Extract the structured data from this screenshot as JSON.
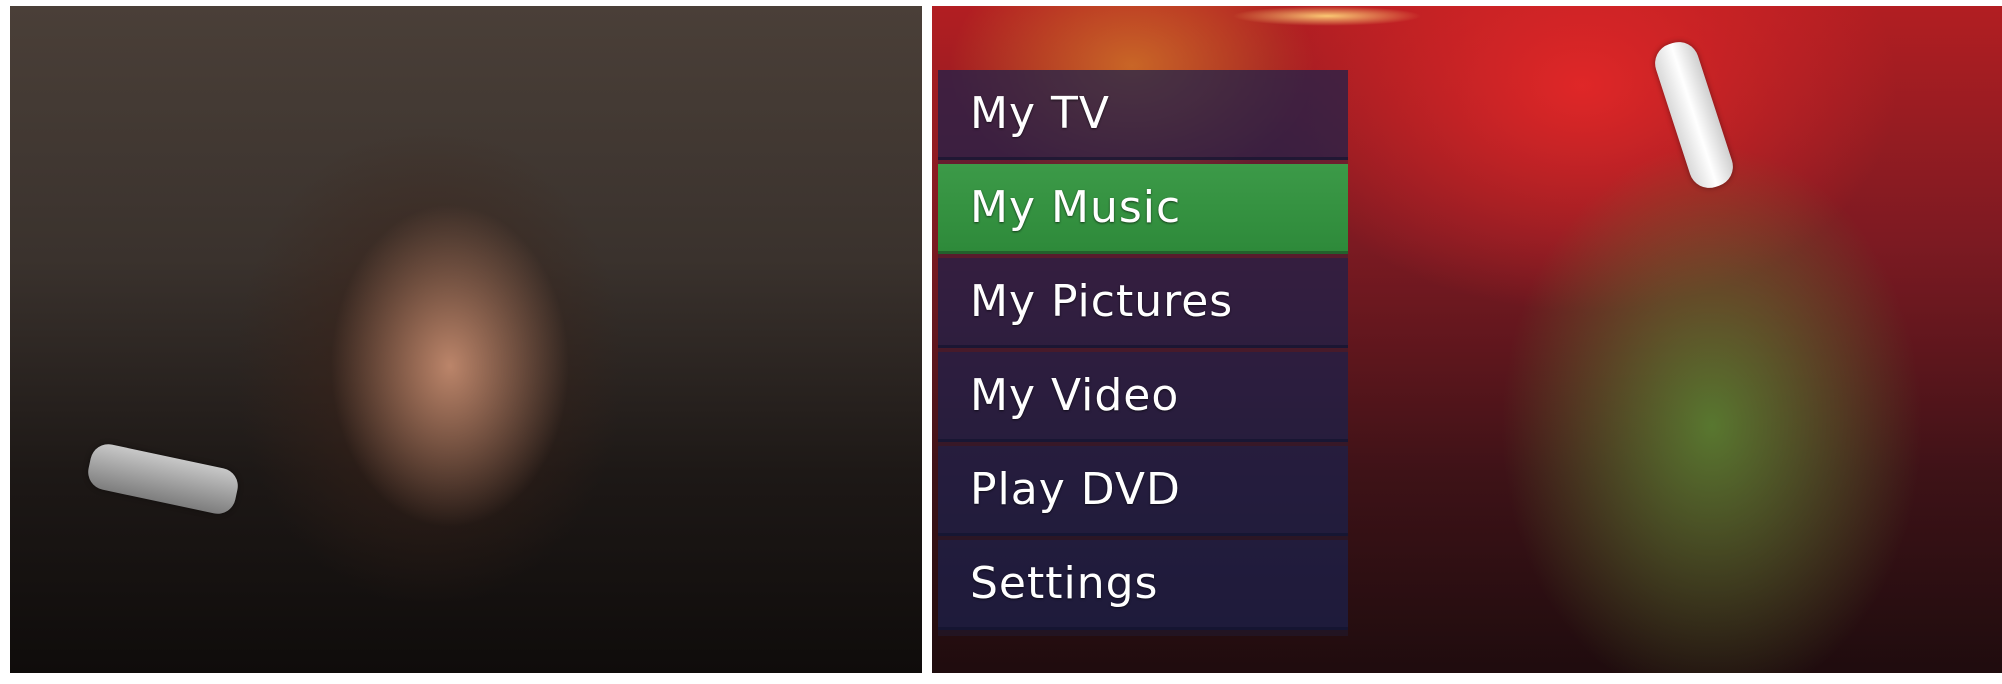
{
  "menu": {
    "items": [
      {
        "label": "My TV",
        "selected": false
      },
      {
        "label": "My Music",
        "selected": true
      },
      {
        "label": "My Pictures",
        "selected": false
      },
      {
        "label": "My Video",
        "selected": false
      },
      {
        "label": "Play DVD",
        "selected": false
      },
      {
        "label": "Settings",
        "selected": false
      }
    ],
    "selected_color": "#2e8a3a",
    "item_color": "#1c204e"
  },
  "photos": {
    "left": "woman-with-remote-photo",
    "right": "cheering-man-with-remote-photo"
  }
}
